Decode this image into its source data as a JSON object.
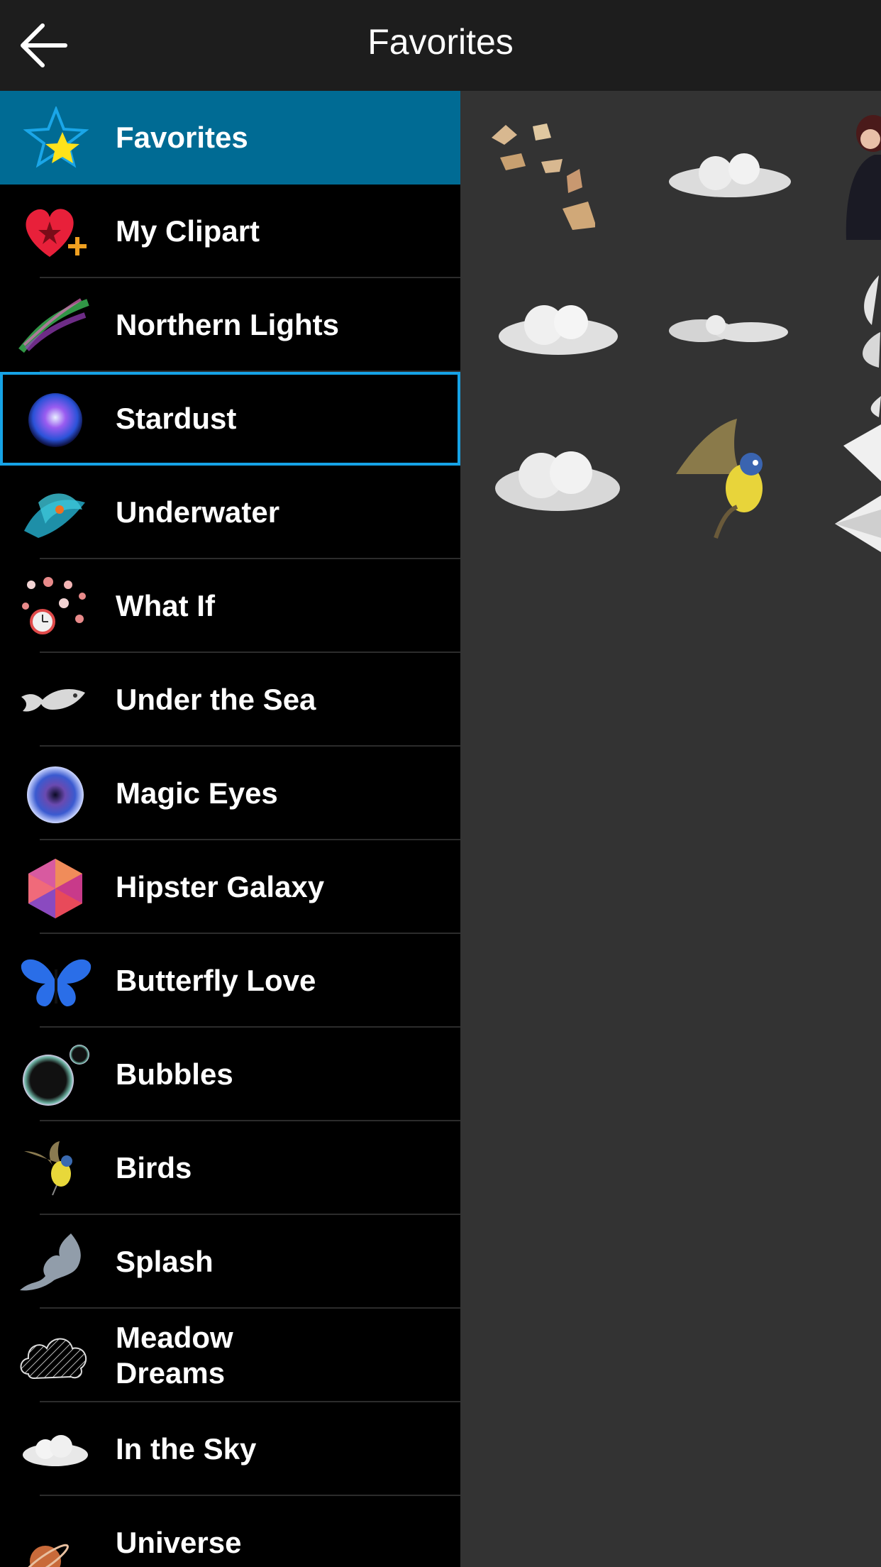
{
  "header": {
    "title": "Favorites",
    "back_icon": "arrow-left-icon"
  },
  "sidebar": {
    "items": [
      {
        "label": "Favorites",
        "icon": "star-icon",
        "state": "active"
      },
      {
        "label": "My Clipart",
        "icon": "heart-plus-icon"
      },
      {
        "label": "Northern Lights",
        "icon": "aurora-icon"
      },
      {
        "label": "Stardust",
        "icon": "nebula-sphere-icon",
        "state": "selected"
      },
      {
        "label": "Underwater",
        "icon": "underwater-fish-icon"
      },
      {
        "label": "What If",
        "icon": "clock-bubbles-icon"
      },
      {
        "label": "Under the Sea",
        "icon": "koi-fish-icon"
      },
      {
        "label": "Magic Eyes",
        "icon": "galaxy-eye-icon"
      },
      {
        "label": "Hipster Galaxy",
        "icon": "hexagon-icon"
      },
      {
        "label": "Butterfly Love",
        "icon": "butterfly-icon"
      },
      {
        "label": "Bubbles",
        "icon": "bubble-icon"
      },
      {
        "label": "Birds",
        "icon": "bird-icon"
      },
      {
        "label": "Splash",
        "icon": "splash-icon"
      },
      {
        "label": "Meadow\nDreams",
        "icon": "patterned-cloud-icon"
      },
      {
        "label": "In the Sky",
        "icon": "cloud-icon"
      },
      {
        "label": "Universe",
        "icon": "planet-icon"
      }
    ]
  },
  "favorites_grid": {
    "thumbnails": [
      "flying-books-clipart",
      "cloud-clipart",
      "woman-clipart",
      "cloud-clipart",
      "small-clouds-clipart",
      "leaves-clipart",
      "cloud-clipart",
      "bird-clipart",
      "paper-plane-clipart"
    ]
  },
  "colors": {
    "header_bg": "#1d1d1d",
    "active_item_bg": "#006b94",
    "selected_outline": "#16a3e6",
    "content_bg": "#333333"
  }
}
